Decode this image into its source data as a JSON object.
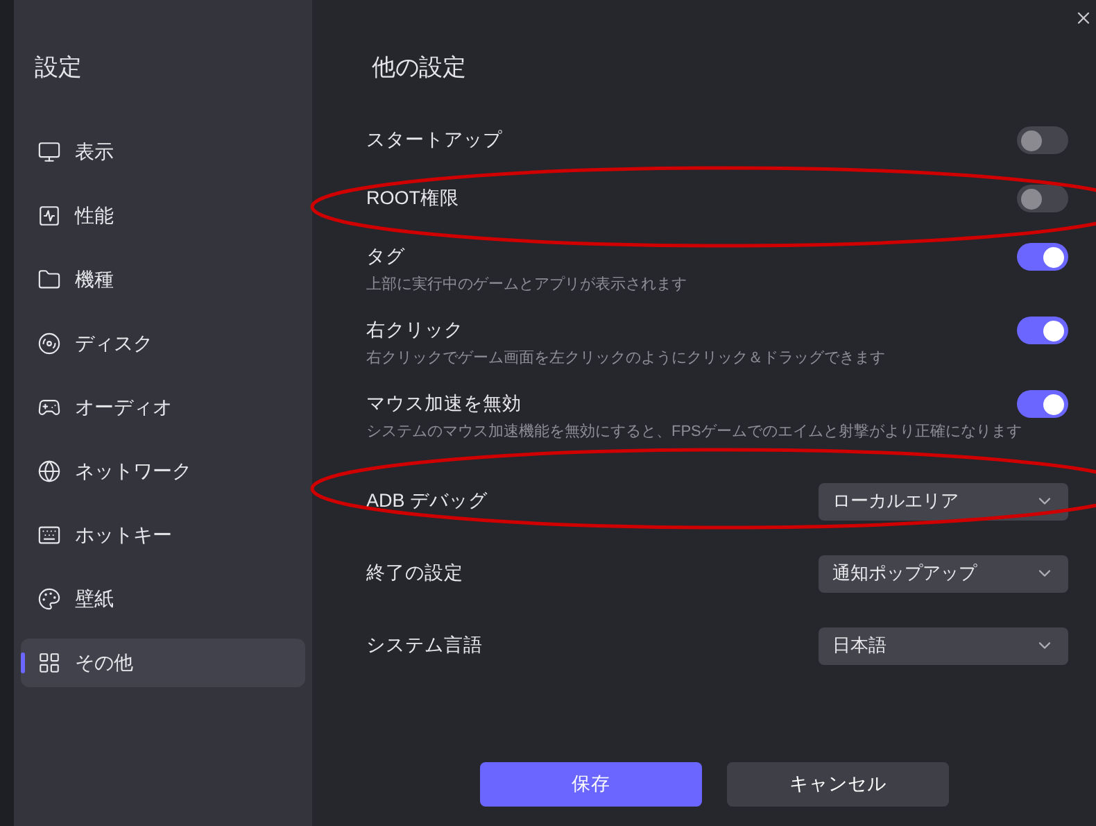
{
  "sidebar": {
    "title": "設定",
    "items": [
      {
        "label": "表示",
        "selected": false
      },
      {
        "label": "性能",
        "selected": false
      },
      {
        "label": "機種",
        "selected": false
      },
      {
        "label": "ディスク",
        "selected": false
      },
      {
        "label": "オーディオ",
        "selected": false
      },
      {
        "label": "ネットワーク",
        "selected": false
      },
      {
        "label": "ホットキー",
        "selected": false
      },
      {
        "label": "壁紙",
        "selected": false
      },
      {
        "label": "その他",
        "selected": true
      }
    ]
  },
  "main": {
    "title": "他の設定",
    "settings": [
      {
        "kind": "toggle",
        "label": "スタートアップ",
        "on": false,
        "highlighted": false
      },
      {
        "kind": "toggle",
        "label": "ROOT権限",
        "on": false,
        "highlighted": true
      },
      {
        "kind": "toggle",
        "label": "タグ",
        "description": "上部に実行中のゲームとアプリが表示されます",
        "on": true,
        "highlighted": false
      },
      {
        "kind": "toggle",
        "label": "右クリック",
        "description": "右クリックでゲーム画面を左クリックのようにクリック＆ドラッグできます",
        "on": true,
        "highlighted": false
      },
      {
        "kind": "toggle",
        "label": "マウス加速を無効",
        "description": "システムのマウス加速機能を無効にすると、FPSゲームでのエイムと射撃がより正確になります",
        "on": true,
        "highlighted": false
      },
      {
        "kind": "select",
        "label": "ADB デバッグ",
        "value": "ローカルエリア",
        "highlighted": true
      },
      {
        "kind": "select",
        "label": "終了の設定",
        "value": "通知ポップアップ",
        "highlighted": false
      },
      {
        "kind": "select",
        "label": "システム言語",
        "value": "日本語",
        "highlighted": false
      }
    ],
    "buttons": [
      {
        "kind": "primary",
        "label": "保存"
      },
      {
        "kind": "secondary",
        "label": "キャンセル"
      }
    ]
  }
}
